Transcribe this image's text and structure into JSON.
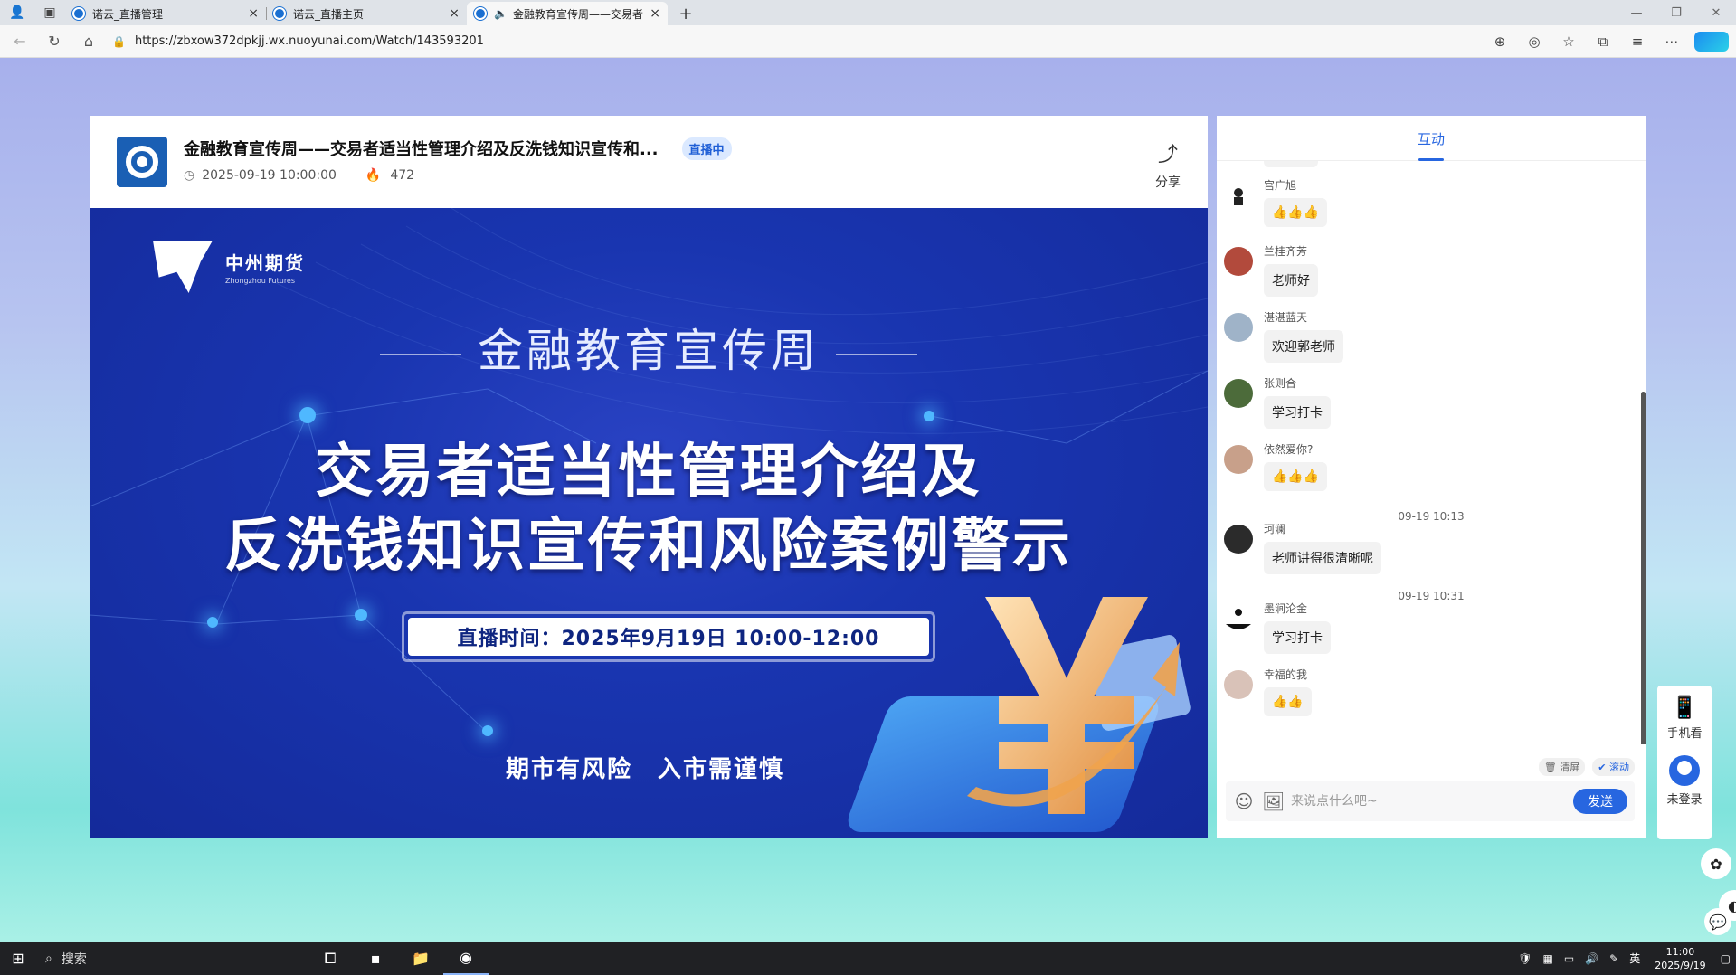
{
  "browser": {
    "tabs": [
      {
        "title": "诺云_直播管理",
        "close": "×"
      },
      {
        "title": "诺云_直播主页",
        "close": "×"
      },
      {
        "title": "金融教育宣传周——交易者",
        "close": "×",
        "active": true
      }
    ],
    "new_tab": "+",
    "window_controls": [
      "—",
      "❐",
      "✕"
    ],
    "url": "https://zbxow372dpkjj.wx.nuoyunai.com/Watch/143593201"
  },
  "player": {
    "title": "金融教育宣传周——交易者适当性管理介绍及反洗钱知识宣传和...",
    "live_badge": "直播中",
    "datetime": "2025-09-19 10:00:00",
    "heat": "472",
    "share_label": "分享"
  },
  "video": {
    "brand_cn": "中州期货",
    "brand_en": "Zhongzhou Futures",
    "subtitle": "金融教育宣传周",
    "line1": "交易者适当性管理介绍及",
    "line2": "反洗钱知识宣传和风险案例警示",
    "time_banner": "直播时间：2025年9月19日 10:00-12:00",
    "slogan": "期市有风险　入市需谨慎"
  },
  "chat": {
    "tab_label": "互动",
    "messages": [
      {
        "name": "宫广旭",
        "text": "👍👍👍",
        "avatar_color": "#222222"
      },
      {
        "name": "兰桂齐芳",
        "text": "老师好",
        "avatar_color": "#b24a3c"
      },
      {
        "name": "湛湛蓝天",
        "text": "欢迎郭老师",
        "avatar_color": "#9fb3c8"
      },
      {
        "name": "张则合",
        "text": "学习打卡",
        "avatar_color": "#4c6b3a"
      },
      {
        "name": "依然爱你?",
        "text": "👍👍👍",
        "avatar_color": "#c8a08a"
      },
      {
        "name": "珂澜",
        "text": "老师讲得很清晰呢",
        "avatar_color": "#2b2b2b"
      },
      {
        "name": "墨涧沦金",
        "text": "学习打卡",
        "avatar_color": "#1a1a1a"
      },
      {
        "name": "幸福的我",
        "text": "👍👍",
        "avatar_color": "#d9c2b8"
      }
    ],
    "timestamps": [
      "09-19 10:13",
      "09-19 10:31"
    ],
    "clear_label": "清屏",
    "scroll_label": "滚动",
    "input_placeholder": "来说点什么吧~",
    "send_label": "发送"
  },
  "side": {
    "mobile_label": "手机看",
    "login_label": "未登录"
  },
  "taskbar": {
    "search_label": "搜索",
    "ime": "英",
    "time": "11:00",
    "date": "2025/9/19"
  }
}
